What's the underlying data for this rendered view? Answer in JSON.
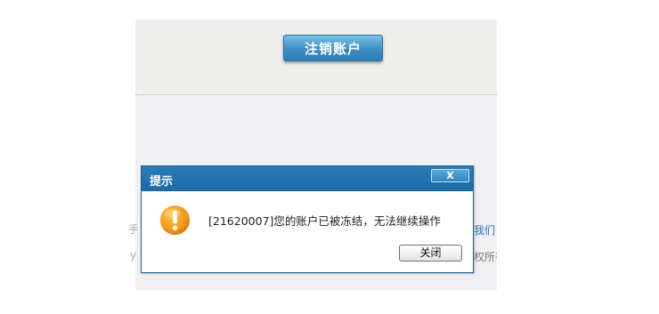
{
  "page": {
    "cancel_account_button": "注销账户",
    "side_left_1": "手",
    "side_left_2": "y",
    "side_right_1": "我们",
    "side_right_2": "权所有"
  },
  "dialog": {
    "title": "提示",
    "close_glyph": "X",
    "message": "[21620007]您的账户已被冻结，无法继续操作",
    "ok_label": "关闭",
    "icon": "warning-icon"
  },
  "colors": {
    "titlebar": "#1d6aa4",
    "button_blue": "#3a8fc4",
    "warning_orange": "#f29a1c",
    "page_bg": "#eeeeec"
  }
}
